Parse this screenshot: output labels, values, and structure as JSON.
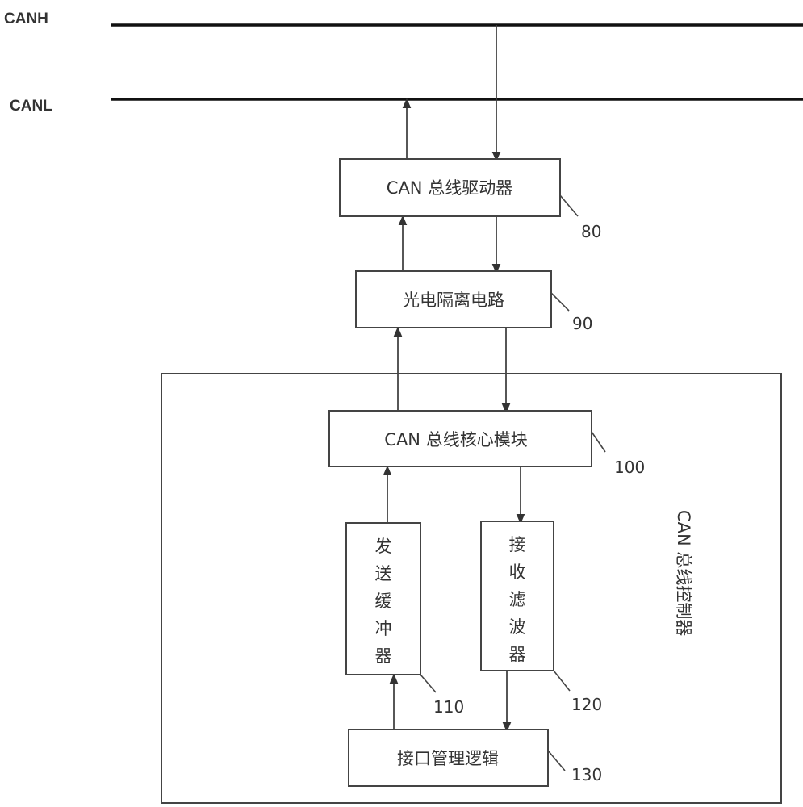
{
  "bus": {
    "canh_label": "CANH",
    "canl_label": "CANL"
  },
  "blocks": {
    "driver": {
      "label": "CAN 总线驱动器",
      "ref": "80"
    },
    "isolation": {
      "label": "光电隔离电路",
      "ref": "90"
    },
    "core": {
      "label": "CAN 总线核心模块",
      "ref": "100"
    },
    "tx_buffer": {
      "label": "发送缓冲器",
      "ref": "110"
    },
    "rx_filter": {
      "label": "接收滤波器",
      "ref": "120"
    },
    "interface": {
      "label": "接口管理逻辑",
      "ref": "130"
    }
  },
  "controller": {
    "label": "CAN 总线控制器"
  },
  "colors": {
    "line": "#444444",
    "bus": "#111111",
    "text": "#333333"
  }
}
